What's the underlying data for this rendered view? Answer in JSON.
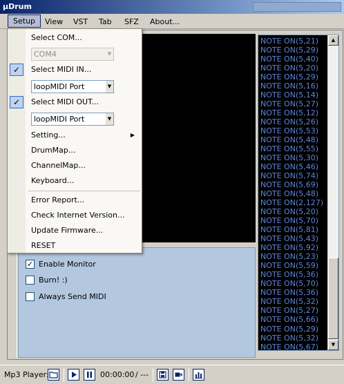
{
  "window": {
    "title": "µDrum"
  },
  "menubar": {
    "items": [
      "Setup",
      "View",
      "VST",
      "Tab",
      "SFZ",
      "About..."
    ]
  },
  "setup_menu": {
    "select_com": "Select COM...",
    "com_value": "COM4",
    "select_midi_in": "Select MIDI IN...",
    "midi_in_value": "loopMIDI Port",
    "select_midi_out": "Select MIDI OUT...",
    "midi_out_value": "loopMIDI Port",
    "setting": "Setting...",
    "drummap": "DrumMap...",
    "channelmap": "ChannelMap...",
    "keyboard": "Keyboard...",
    "error_report": "Error Report...",
    "check_version": "Check Internet Version...",
    "update_firmware": "Update Firmware...",
    "reset": "RESET"
  },
  "options": {
    "enable_monitor": {
      "label": "Enable Monitor",
      "checked": true
    },
    "burn": {
      "label": "Burn! :)",
      "checked": false
    },
    "always_send": {
      "label": "Always Send MIDI",
      "checked": false
    }
  },
  "midi_log": [
    "NOTE ON(5,21)",
    "NOTE ON(5,29)",
    "NOTE ON(5,40)",
    "NOTE ON(5,20)",
    "NOTE ON(5,29)",
    "NOTE ON(5,16)",
    "NOTE ON(5,14)",
    "NOTE ON(5,27)",
    "NOTE ON(5,12)",
    "NOTE ON(5,26)",
    "NOTE ON(5,53)",
    "NOTE ON(5,48)",
    "NOTE ON(5,55)",
    "NOTE ON(5,30)",
    "NOTE ON(5,46)",
    "NOTE ON(5,74)",
    "NOTE ON(5,69)",
    "NOTE ON(5,48)",
    "NOTE ON(2,127)",
    "NOTE ON(5,20)",
    "NOTE ON(5,70)",
    "NOTE ON(5,81)",
    "NOTE ON(5,43)",
    "NOTE ON(5,92)",
    "NOTE ON(5,23)",
    "NOTE ON(5,59)",
    "NOTE ON(5,36)",
    "NOTE ON(5,70)",
    "NOTE ON(5,36)",
    "NOTE ON(5,32)",
    "NOTE ON(5,27)",
    "NOTE ON(5,66)",
    "NOTE ON(5,29)",
    "NOTE ON(5,32)",
    "NOTE ON(5,67)"
  ],
  "player": {
    "label": "Mp3 Player:",
    "time": "00:00:00",
    "duration": "/ ---"
  },
  "colors": {
    "log_text": "#5d86d9",
    "panel_bg": "#b3c7df",
    "title_bar": "#0a246a"
  }
}
